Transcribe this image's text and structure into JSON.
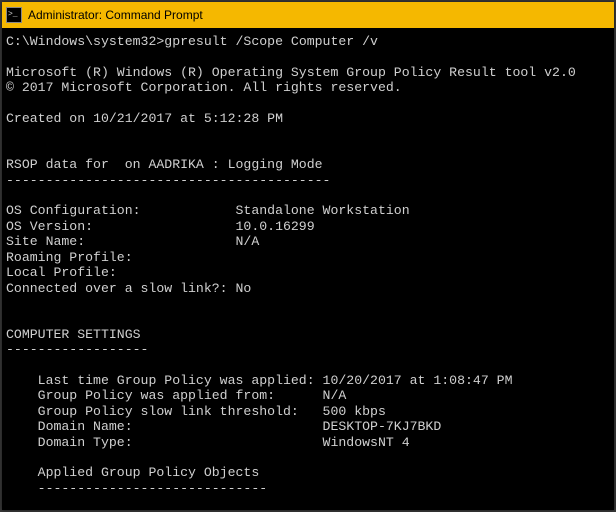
{
  "titlebar": {
    "text": "Administrator: Command Prompt"
  },
  "prompt": {
    "path": "C:\\Windows\\system32>",
    "command": "gpresult /Scope Computer /v"
  },
  "header": {
    "l1": "Microsoft (R) Windows (R) Operating System Group Policy Result tool v2.0",
    "l2": "© 2017 Microsoft Corporation. All rights reserved."
  },
  "created": {
    "prefix": "Created on ",
    "date": "‎10/‎21/‎2017",
    "middle": " at ",
    "time": "5:12:28 PM"
  },
  "rsop": {
    "line": "RSOP data for  on AADRIKA : Logging Mode",
    "dash": "-----------------------------------------"
  },
  "os": {
    "config": "OS Configuration:            Standalone Workstation",
    "version": "OS Version:                  10.0.16299",
    "site": "Site Name:                   N/A",
    "roaming": "Roaming Profile:",
    "local": "Local Profile:",
    "slowlink": "Connected over a slow link?: No"
  },
  "cs": {
    "heading": "COMPUTER SETTINGS",
    "dash": "------------------"
  },
  "gp": {
    "last": "    Last time Group Policy was applied: 10/20/2017 at 1:08:47 PM",
    "from": "    Group Policy was applied from:      N/A",
    "thresh": "    Group Policy slow link threshold:   500 kbps",
    "domain": "    Domain Name:                        DESKTOP-7KJ7BKD",
    "type": "    Domain Type:                        WindowsNT 4"
  },
  "applied": {
    "heading": "    Applied Group Policy Objects",
    "dash": "    -----------------------------"
  }
}
